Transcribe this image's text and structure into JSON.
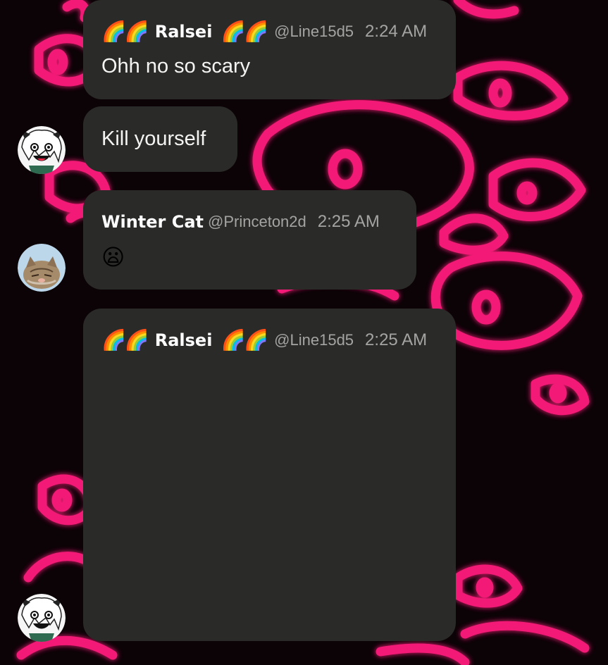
{
  "messages": [
    {
      "id": "m1",
      "emoji_left": "🌈🌈",
      "name": "Ralsei",
      "emoji_right": "🌈🌈",
      "handle": "@Line15d5",
      "time": "2:24 AM",
      "text": "Ohh no so scary"
    },
    {
      "id": "m2",
      "text": "Kill yourself"
    },
    {
      "id": "m3",
      "name": "Winter Cat",
      "handle": "@Princeton2d",
      "time": "2:25 AM",
      "text": "😦"
    },
    {
      "id": "m4",
      "emoji_left": "🌈🌈",
      "name": "Ralsei",
      "emoji_right": "🌈🌈",
      "handle": "@Line15d5",
      "time": "2:25 AM",
      "text": ""
    }
  ],
  "avatars": {
    "ralsei": "ralsei-avatar",
    "winter_cat": "winter-cat-avatar"
  },
  "colors": {
    "background": "#0c0306",
    "neon_pink": "#ff1f7c",
    "bubble": "#2a2b28",
    "name_text": "#ffffff",
    "meta_text": "#a4a4a2"
  }
}
